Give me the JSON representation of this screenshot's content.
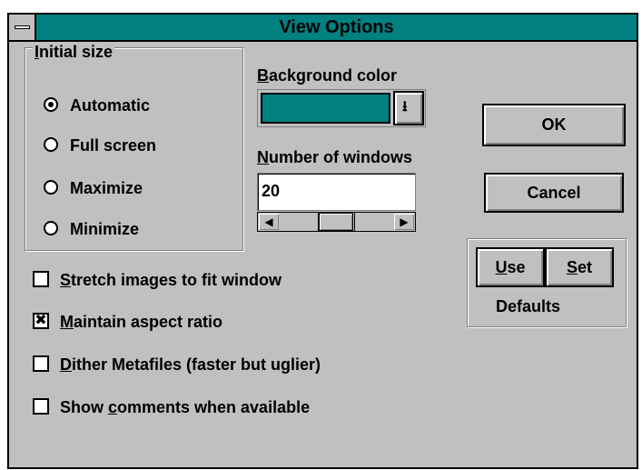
{
  "dialog": {
    "title": "View Options",
    "initial_size": {
      "label": "Initial size",
      "options": [
        {
          "label": "Automatic",
          "selected": true
        },
        {
          "label": "Full screen",
          "selected": false
        },
        {
          "label": "Maximize",
          "selected": false
        },
        {
          "label": "Minimize",
          "selected": false
        }
      ]
    },
    "background_color": {
      "label": "Background color",
      "selected_color": "#008080"
    },
    "number_of_windows": {
      "label": "Number of windows",
      "value": "20"
    },
    "buttons": {
      "ok": "OK",
      "cancel": "Cancel",
      "use": "Use",
      "set": "Set",
      "defaults_label": "Defaults"
    },
    "checkboxes": [
      {
        "label": "Stretch images to fit window",
        "checked": false
      },
      {
        "label": "Maintain aspect ratio",
        "checked": true
      },
      {
        "label": "Dither Metafiles (faster but uglier)",
        "checked": false
      },
      {
        "label": "Show comments when available",
        "checked": false
      }
    ],
    "icons": {
      "system_menu": "system-menu-icon",
      "dropdown": "dropdown-arrow-icon",
      "scroll_left": "arrow-left-icon",
      "scroll_right": "arrow-right-icon",
      "check_mark": "x-mark-icon"
    },
    "colors": {
      "title_bar": "#008080",
      "face": "#c0c0c0"
    }
  }
}
